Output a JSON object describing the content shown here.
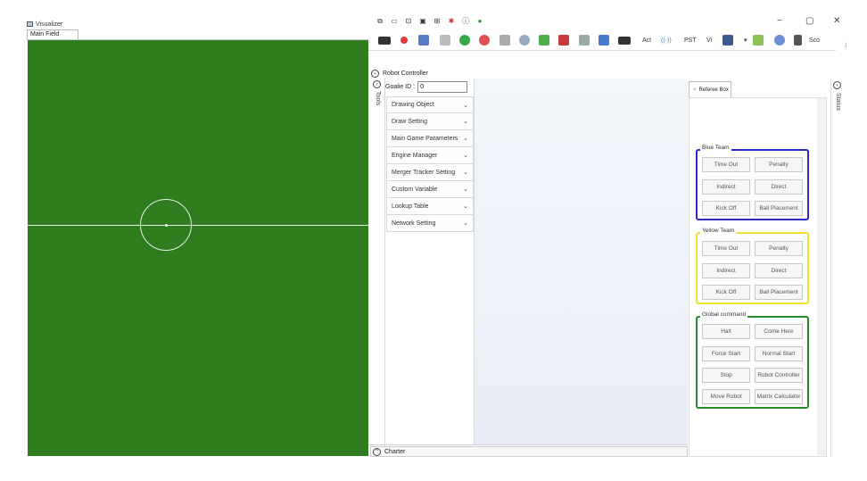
{
  "visualizer": {
    "title": "Visualizer",
    "tab": "Main Field",
    "field_color": "#2e7d1e"
  },
  "window_controls": {
    "minimize": "−",
    "maximize": "▢",
    "close": "✕"
  },
  "toolbar": {
    "text_items": [
      "Act",
      "PST",
      "Vi",
      "Sco"
    ]
  },
  "robot_controller": {
    "header": "Robot Controller",
    "tools_label": "Tools",
    "goalie_label": "Goalie ID :",
    "goalie_value": "0",
    "items": [
      "Drawing Object",
      "Draw Setting",
      "Main Game Parameters",
      "Engine Manager",
      "Merger Tracker Setting",
      "Custom Variable",
      "Lookup Table",
      "Network Setting"
    ],
    "charter": "Charter"
  },
  "referee": {
    "tab": "Referee Box",
    "tab_close": "×",
    "blue_team": {
      "label": "Blue Team",
      "color": "#2a2ac8",
      "buttons": [
        "Time Out",
        "Penalty",
        "Indirect",
        "Direct",
        "Kick Off",
        "Ball Placement"
      ]
    },
    "yellow_team": {
      "label": "Yellow Team",
      "color": "#f2e233",
      "buttons": [
        "Time Out",
        "Penalty",
        "Indirect",
        "Direct",
        "Kick Off",
        "Ball Placement"
      ]
    },
    "global": {
      "label": "Global command",
      "color": "#2a8a2a",
      "buttons": [
        "Halt",
        "Come Here",
        "Force Start",
        "Normal Start",
        "Stop",
        "Robot Controller",
        "Move Robot",
        "Matrix Calculator"
      ]
    }
  },
  "status": {
    "label": "Status"
  }
}
